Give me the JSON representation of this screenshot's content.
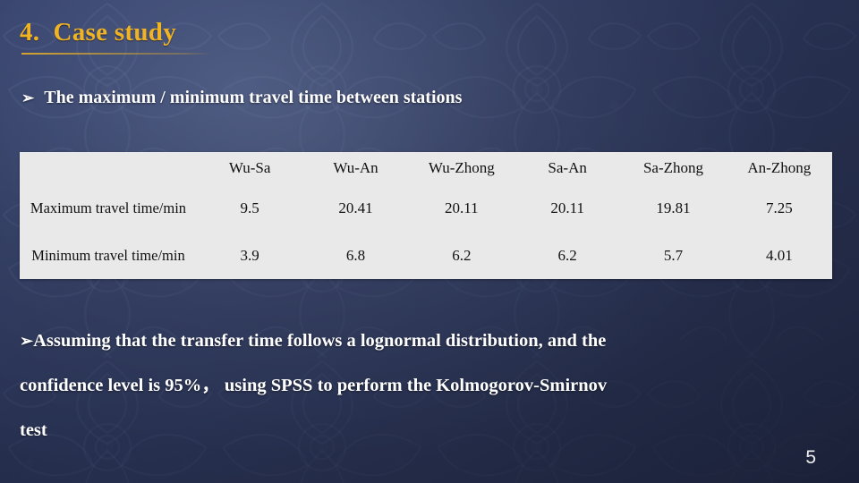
{
  "slide": {
    "title": "4.  Case study",
    "page_number": "5",
    "accent_color": "#f0b323",
    "text_color": "#ffffff",
    "background_color": "#2c3659",
    "table_background": "#e9e9e9"
  },
  "subtitle": {
    "bullet_icon": "arrow-bullet-outline-icon",
    "bullet_glyph": "➢",
    "text": "The maximum / minimum travel time between stations"
  },
  "table": {
    "corner_label": "",
    "columns": [
      "Wu-Sa",
      "Wu-An",
      "Wu-Zhong",
      "Sa-An",
      "Sa-Zhong",
      "An-Zhong"
    ],
    "rows": [
      {
        "label": "Maximum travel time/min",
        "values": [
          "9.5",
          "20.41",
          "20.11",
          "20.11",
          "19.81",
          "7.25"
        ]
      },
      {
        "label": "Minimum travel time/min",
        "values": [
          "3.9",
          "6.8",
          "6.2",
          "6.2",
          "5.7",
          "4.01"
        ]
      }
    ]
  },
  "body": {
    "bullet_glyph": "➢",
    "lines": [
      "Assuming that the transfer time follows a lognormal distribution, and the",
      "confidence level is 95%， using  SPSS to perform the Kolmogorov-Smirnov",
      "test"
    ]
  }
}
